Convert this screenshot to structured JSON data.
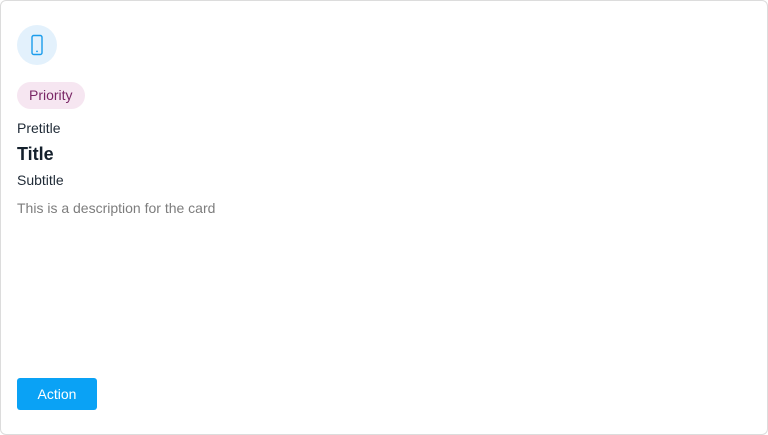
{
  "card": {
    "icon": "mobile-phone-icon",
    "badge": "Priority",
    "pretitle": "Pretitle",
    "title": "Title",
    "subtitle": "Subtitle",
    "description": "This is a description for the card",
    "action_label": "Action"
  },
  "colors": {
    "accent": "#0aa2f5",
    "icon_bg": "#e3f1fc",
    "badge_bg": "#f6e6f1",
    "badge_text": "#7a2766",
    "border": "#dcdcdc"
  }
}
